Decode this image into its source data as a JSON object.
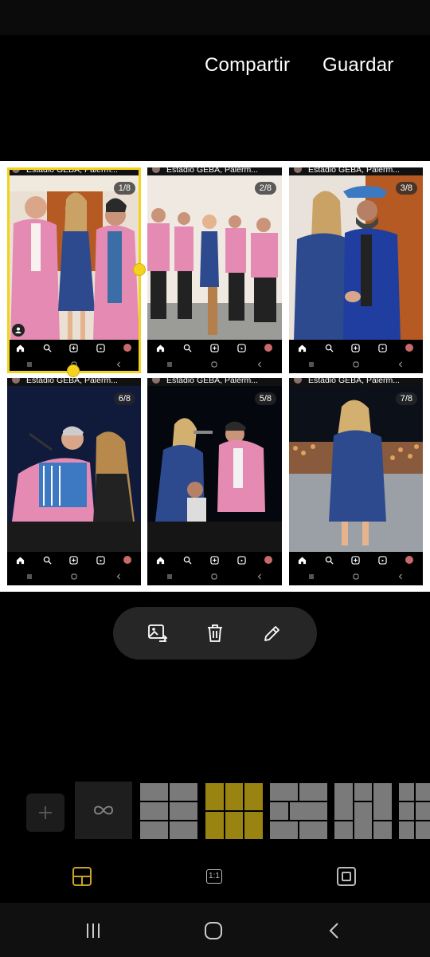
{
  "top_actions": {
    "share_label": "Compartir",
    "save_label": "Guardar"
  },
  "collage": {
    "location_text": "Estadio GEBA, Palerm...",
    "cells": [
      {
        "counter": "1/8"
      },
      {
        "counter": "2/8"
      },
      {
        "counter": "3/8"
      },
      {
        "counter": "6/8"
      },
      {
        "counter": "5/8"
      },
      {
        "counter": "7/8"
      }
    ]
  },
  "edit_tools": [
    {
      "icon": "replace-image-icon"
    },
    {
      "icon": "trash-icon"
    },
    {
      "icon": "pencil-icon"
    }
  ],
  "layout_tabs": {
    "ratio_label": "1:1"
  },
  "colors": {
    "accent": "#f2d21b",
    "selected_layout": "#9a8411",
    "layout_tile": "#7a7a7a",
    "background": "#000000"
  }
}
